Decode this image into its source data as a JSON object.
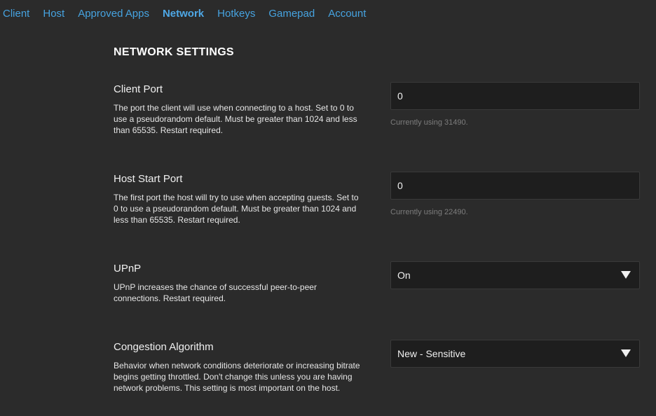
{
  "nav": {
    "tabs": [
      {
        "label": "Client",
        "active": false
      },
      {
        "label": "Host",
        "active": false
      },
      {
        "label": "Approved Apps",
        "active": false
      },
      {
        "label": "Network",
        "active": true
      },
      {
        "label": "Hotkeys",
        "active": false
      },
      {
        "label": "Gamepad",
        "active": false
      },
      {
        "label": "Account",
        "active": false
      }
    ]
  },
  "page": {
    "title": "NETWORK SETTINGS"
  },
  "settings": {
    "client_port": {
      "label": "Client Port",
      "description": "The port the client will use when connecting to a host. Set to 0 to use a pseudorandom default. Must be greater than 1024 and less than 65535. Restart required.",
      "value": "0",
      "hint": "Currently using 31490."
    },
    "host_start_port": {
      "label": "Host Start Port",
      "description": "The first port the host will try to use when accepting guests. Set to 0 to use a pseudorandom default. Must be greater than 1024 and less than 65535. Restart required.",
      "value": "0",
      "hint": "Currently using 22490."
    },
    "upnp": {
      "label": "UPnP",
      "description": "UPnP increases the chance of successful peer-to-peer connections. Restart required.",
      "selected": "On"
    },
    "congestion": {
      "label": "Congestion Algorithm",
      "description": "Behavior when network conditions deteriorate or increasing bitrate begins getting throttled. Don't change this unless you are having network problems. This setting is most important on the host.",
      "selected": "New - Sensitive"
    }
  },
  "colors": {
    "background": "#2b2b2b",
    "accent": "#46a3e0",
    "control_bg": "#1e1e1e",
    "hint": "#7d7d7d"
  }
}
